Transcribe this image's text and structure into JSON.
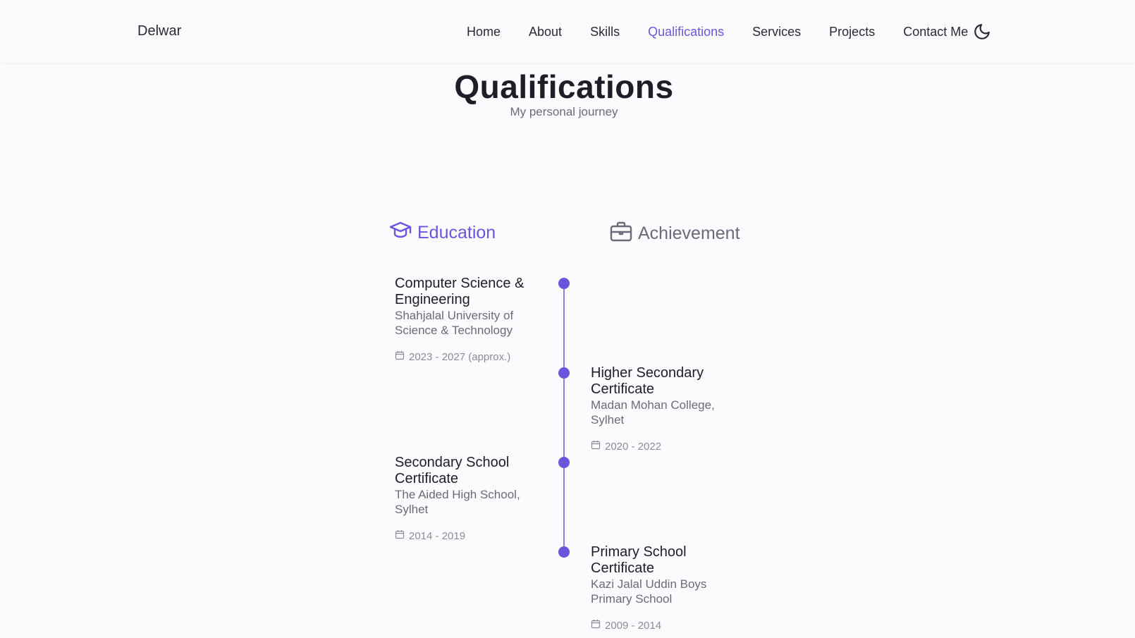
{
  "header": {
    "logo": "Delwar",
    "nav": [
      {
        "label": "Home"
      },
      {
        "label": "About"
      },
      {
        "label": "Skills"
      },
      {
        "label": "Qualifications"
      },
      {
        "label": "Services"
      },
      {
        "label": "Projects"
      },
      {
        "label": "Contact Me"
      }
    ],
    "active_nav": "Qualifications",
    "theme_icon": "moon-icon"
  },
  "section": {
    "title": "Qualifications",
    "subtitle": "My personal journey"
  },
  "tabs": {
    "education": {
      "label": "Education",
      "icon": "graduation-cap-icon",
      "active": true
    },
    "achievement": {
      "label": "Achievement",
      "icon": "briefcase-icon",
      "active": false
    }
  },
  "timeline": [
    {
      "side": "left",
      "title": "Computer Science & Engineering",
      "subtitle": "Shahjalal University of Science & Technology",
      "date": "2023 - 2027 (approx.)"
    },
    {
      "side": "right",
      "title": "Higher Secondary Certificate",
      "subtitle": "Madan Mohan College, Sylhet",
      "date": "2020 - 2022"
    },
    {
      "side": "left",
      "title": "Secondary School Certificate",
      "subtitle": "The Aided High School, Sylhet",
      "date": "2014 - 2019"
    },
    {
      "side": "right",
      "title": "Primary School Certificate",
      "subtitle": "Kazi Jalal Uddin Boys Primary School",
      "date": "2009 - 2014"
    }
  ],
  "colors": {
    "accent": "#6a55dd",
    "text": "#2a2935",
    "muted": "#6b6a7a",
    "background": "#fbfbfe"
  }
}
